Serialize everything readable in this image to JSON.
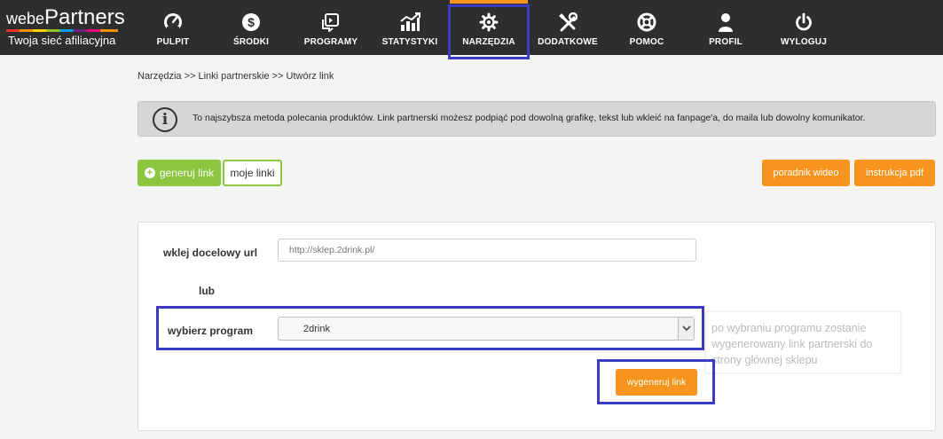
{
  "logo": {
    "brand_small": "webe",
    "brand_big": "Partners",
    "tagline": "Twoja sieć afiliacyjna"
  },
  "nav": {
    "items": [
      {
        "label": "PULPIT",
        "icon": "speedometer-icon"
      },
      {
        "label": "ŚRODKI",
        "icon": "dollar-icon"
      },
      {
        "label": "PROGRAMY",
        "icon": "programs-icon"
      },
      {
        "label": "STATYSTYKI",
        "icon": "chart-icon"
      },
      {
        "label": "NARZĘDZIA",
        "icon": "gear-icon"
      },
      {
        "label": "DODATKOWE",
        "icon": "tools-icon"
      },
      {
        "label": "POMOC",
        "icon": "lifebuoy-icon"
      },
      {
        "label": "PROFIL",
        "icon": "user-icon"
      },
      {
        "label": "WYLOGUJ",
        "icon": "power-icon"
      }
    ],
    "active": "NARZĘDZIA",
    "active_color": "#f7941d"
  },
  "breadcrumb": "Narzędzia >> Linki partnerskie >> Utwórz link",
  "info": {
    "icon": "info-icon",
    "glyph": "i",
    "text": "To najszybsza metoda polecania produktów. Link partnerski możesz podpiąć pod dowolną grafikę, tekst lub wkleić na fanpage'a, do maila lub dowolny komunikator."
  },
  "actions": {
    "generate": "generuj link",
    "my_links": "moje linki",
    "video_guide": "poradnik wideo",
    "pdf_guide": "instrukcja pdf"
  },
  "form": {
    "url_label": "wklej docelowy url",
    "url_placeholder": "http://sklep.2drink.pl/",
    "or_label": "lub",
    "program_label": "wybierz program",
    "program_selected": "2drink",
    "hint": "po wybraniu programu zostanie wygenerowany link partnerski do strony głównej sklepu",
    "submit": "wygeneruj link"
  },
  "colors": {
    "topbar": "#2e2e2e",
    "green": "#8cc63f",
    "orange": "#f7941d",
    "highlight": "#3b3bc4"
  }
}
